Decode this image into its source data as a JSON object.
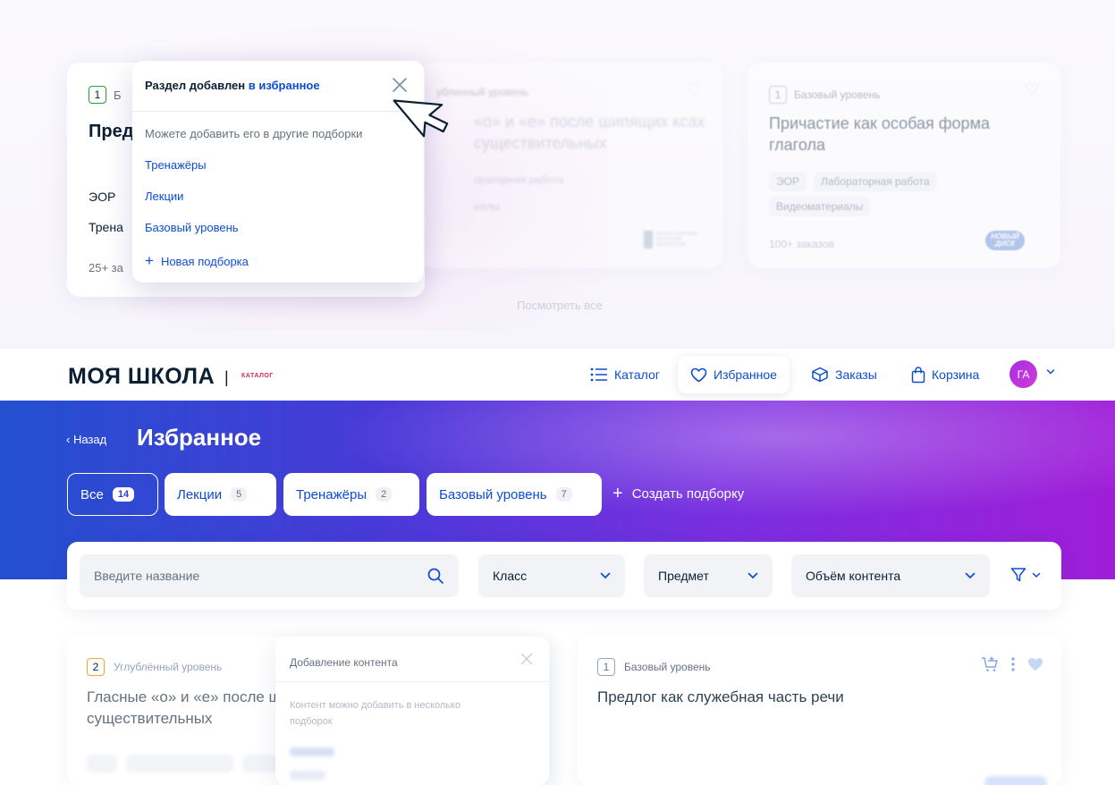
{
  "top": {
    "card1": {
      "level_num": "1",
      "level_label": "Б",
      "title": "Пред",
      "tag1": "ЭОР",
      "tag2": "Трена",
      "orders": "25+ за"
    },
    "card2": {
      "level": "убленный уровень",
      "title": "«о» и «е» после шипящих ксах существительных",
      "tag": "ораторная работа",
      "tag2": "иалы",
      "logo_text": "ВСЕРОССИЙСКАЯ ШКОЛЬНАЯ БИБЛИОТЕКА"
    },
    "card3": {
      "level_num": "1",
      "level_label": "Базовый уровень",
      "title": "Причастие как особая форма глагола",
      "tags": [
        "ЭОР",
        "Лабораторная работа"
      ],
      "tag_row2": "Видеоматериалы",
      "orders": "100+ заказов",
      "logo_text": "НОВЫЙ ДИСК"
    },
    "view_all": "Посмотреть все",
    "popup": {
      "head_prefix": "Раздел добавлен",
      "head_link": "в избранное",
      "subtitle": "Можете добавить его в другие подборки",
      "items": [
        "Тренажёры",
        "Лекции",
        "Базовый уровень"
      ],
      "new_collection": "Новая подборка"
    }
  },
  "header": {
    "logo": "МОЯ ШКОЛА",
    "logo_sep": "|",
    "logo_sub": "КАТАЛОГ",
    "nav": {
      "catalog": "Каталог",
      "favorites": "Избранное",
      "orders": "Заказы",
      "cart": "Корзина"
    },
    "avatar": "ГА"
  },
  "hero": {
    "back": "‹ Назад",
    "title": "Избранное",
    "chips": [
      {
        "label": "Все",
        "count": "14"
      },
      {
        "label": "Лекции",
        "count": "5"
      },
      {
        "label": "Тренажёры",
        "count": "2"
      },
      {
        "label": "Базовый уровень",
        "count": "7"
      }
    ],
    "create": "Создать подборку"
  },
  "filters": {
    "search_placeholder": "Введите название",
    "class_label": "Класс",
    "subject_label": "Предмет",
    "volume_label": "Объём контента"
  },
  "bottom": {
    "card1": {
      "level_num": "2",
      "level_label": "Углублённый уровень",
      "title": "Гласные «о» и «е» после ш существительных"
    },
    "popup": {
      "title": "Добавление контента",
      "text": "Контент можно добавить в несколько подборок"
    },
    "card2": {
      "level_num": "1",
      "level_label": "Базовый уровень",
      "title": "Предлог как служебная часть речи"
    }
  },
  "colors": {
    "primary": "#0d4cd3",
    "text": "#0b1f33",
    "muted": "#66727f",
    "gradient_start": "#2250cf",
    "gradient_end": "#9f1ed8",
    "level_green": "#1ea33a",
    "level_orange": "#f5a623"
  }
}
